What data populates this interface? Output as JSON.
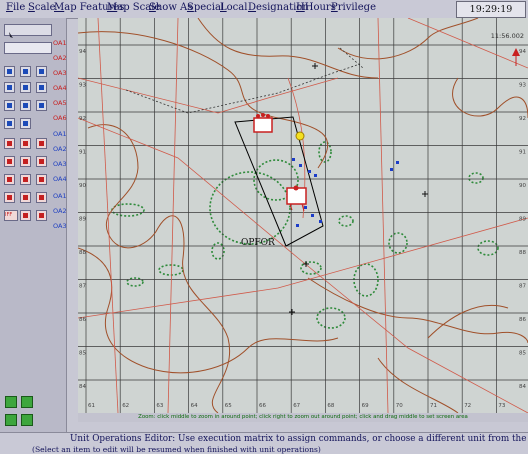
{
  "menubar": {
    "items": [
      "File",
      "Scale",
      "Map Features",
      "Map Scale",
      "Show As",
      "Special",
      "Local",
      "Designation",
      "HHours",
      "Privilege"
    ],
    "clock": "19:29:19 GMT"
  },
  "toolbox": {
    "oa_labels": [
      "OA1",
      "OA2",
      "OA3",
      "OA4",
      "OA5",
      "OA6",
      "OA1",
      "OA2",
      "OA3",
      "OA4",
      "OA1",
      "OA2",
      "OA3"
    ],
    "id_tool_label": "IFF"
  },
  "map": {
    "time_label": "11:56.002",
    "unit_label": "OPFOR",
    "grid_x_labels": [
      "61",
      "62",
      "63",
      "64",
      "65",
      "66",
      "67",
      "68",
      "69",
      "70",
      "71",
      "72",
      "73"
    ],
    "grid_y_labels": [
      "94",
      "93",
      "92",
      "91",
      "90",
      "89",
      "88",
      "87",
      "86",
      "85",
      "84"
    ]
  },
  "hint": "Zoom: click middle to zoom in around point; click right to zoom out around point; click and drag middle to set screen area",
  "status": {
    "main": "Unit Operations Editor: Use execution matrix to assign commands, or choose a different unit from the map",
    "sub": "(Select an item to edit will be resumed when finished with unit operations)"
  },
  "colors": {
    "grid": "#3a3a3a",
    "contour": "#a0502a",
    "road": "#d05a4a",
    "vegetation": "#2e8a3a",
    "friendly": "#1c3cc8",
    "hostile": "#c82020"
  }
}
